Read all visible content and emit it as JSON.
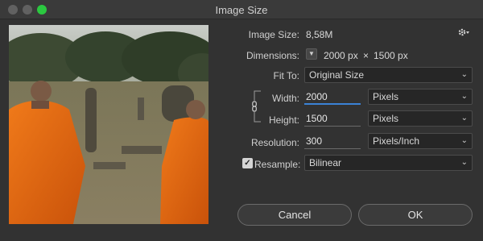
{
  "window": {
    "title": "Image Size"
  },
  "image_size": {
    "label": "Image Size:",
    "value": "8,58M"
  },
  "dimensions": {
    "label": "Dimensions:",
    "width": "2000 px",
    "times": "×",
    "height": "1500 px"
  },
  "fit_to": {
    "label": "Fit To:",
    "value": "Original Size"
  },
  "width": {
    "label": "Width:",
    "value": "2000",
    "unit": "Pixels"
  },
  "height": {
    "label": "Height:",
    "value": "1500",
    "unit": "Pixels"
  },
  "resolution": {
    "label": "Resolution:",
    "value": "300",
    "unit": "Pixels/Inch"
  },
  "resample": {
    "label": "Resample:",
    "checked": true,
    "value": "Bilinear"
  },
  "buttons": {
    "cancel": "Cancel",
    "ok": "OK"
  },
  "icons": {
    "settings": "gear-icon",
    "link": "link-icon",
    "chevron": "chevron-down-icon"
  }
}
